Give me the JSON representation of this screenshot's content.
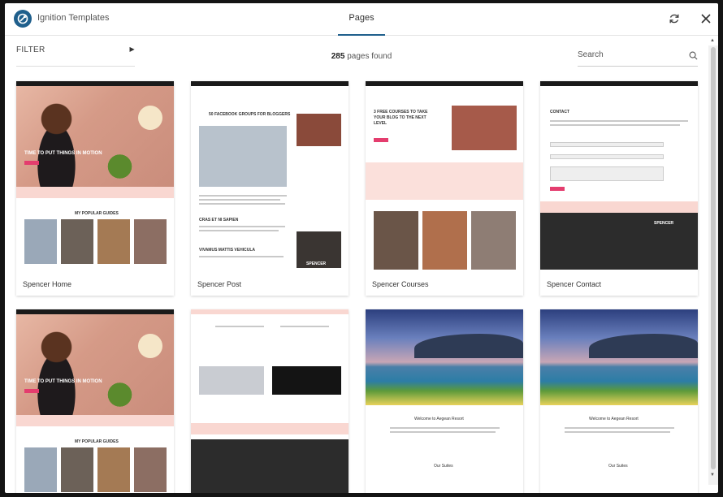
{
  "header": {
    "app_title": "Ignition Templates",
    "tab_label": "Pages"
  },
  "toolbar": {
    "filter_label": "FILTER",
    "count_number": "285",
    "count_suffix": "pages found",
    "search_placeholder": "Search"
  },
  "cards": [
    {
      "label": "Spencer Home"
    },
    {
      "label": "Spencer Post"
    },
    {
      "label": "Spencer Courses"
    },
    {
      "label": "Spencer Contact"
    },
    {
      "label": ""
    },
    {
      "label": ""
    },
    {
      "label": ""
    },
    {
      "label": ""
    }
  ],
  "thumb_text": {
    "home_hero": "TIME TO PUT THINGS IN MOTION",
    "home_popular": "MY POPULAR GUIDES",
    "post_title": "50 FACEBOOK GROUPS FOR BLOGGERS",
    "post_sub1": "CRAS ET NI SAPIEN",
    "post_sub2": "VIVAMUS MATTIS VEHICULA",
    "post_brand": "SPENCER",
    "courses_title": "3 FREE COURSES TO TAKE YOUR BLOG TO THE NEXT LEVEL",
    "contact_title": "CONTACT",
    "contact_brand": "SPENCER",
    "resort_title": "Welcome to Aegean Resort",
    "resort_suites": "Our Suites"
  },
  "colors": {
    "accent": "#1f5f8c",
    "pink": "#e43d6e",
    "pink_light": "#f9d7d1"
  }
}
